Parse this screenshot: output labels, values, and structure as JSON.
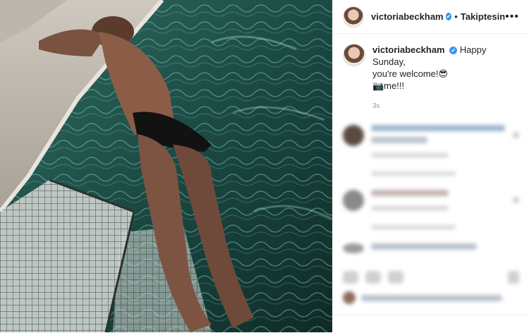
{
  "header": {
    "username": "victoriabeckham",
    "verified_glyph": "✔",
    "separator": "•",
    "follow_label": "Takiptesin",
    "more_glyph": "•••"
  },
  "post": {
    "username": "victoriabeckham",
    "verified_glyph": "✔",
    "caption_line1": "Happy Sunday,",
    "caption_line2": "you're welcome!😎",
    "caption_line3": "📷me!!!",
    "time": "3s"
  },
  "icons": {
    "verified": "verified-badge-icon",
    "more": "more-options-icon",
    "like": "heart-icon",
    "comment": "comment-icon",
    "share": "share-icon",
    "save": "bookmark-icon"
  },
  "colors": {
    "pool_water": "#1a3b36",
    "verified_blue": "#3897f0"
  }
}
